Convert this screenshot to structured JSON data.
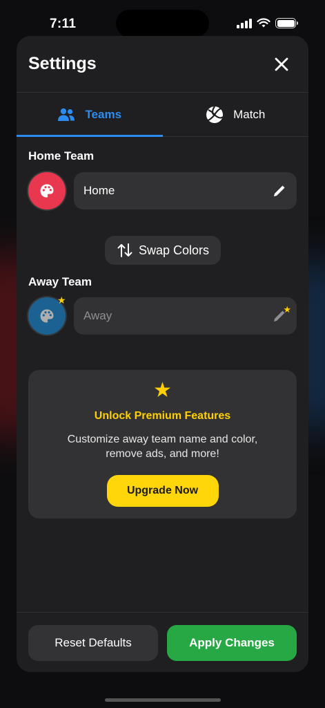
{
  "status_bar": {
    "time": "7:11"
  },
  "sheet": {
    "title": "Settings",
    "tabs": [
      {
        "label": "Teams",
        "icon": "people-icon",
        "active": true
      },
      {
        "label": "Match",
        "icon": "volleyball-icon",
        "active": false
      }
    ],
    "home_team": {
      "label": "Home Team",
      "name": "Home",
      "color": "#e8374f",
      "icon": "palette-icon"
    },
    "swap_label": "Swap Colors",
    "away_team": {
      "label": "Away Team",
      "placeholder": "Away",
      "color": "#1b6ea6",
      "icon": "palette-icon",
      "locked": true
    },
    "premium": {
      "icon": "★",
      "title": "Unlock Premium Features",
      "description": "Customize away team name and color, remove ads, and more!",
      "button": "Upgrade Now"
    },
    "footer": {
      "reset_label": "Reset Defaults",
      "apply_label": "Apply Changes"
    }
  },
  "colors": {
    "accent": "#2d8cf0",
    "premium": "#ffd60a",
    "apply": "#27a845"
  }
}
